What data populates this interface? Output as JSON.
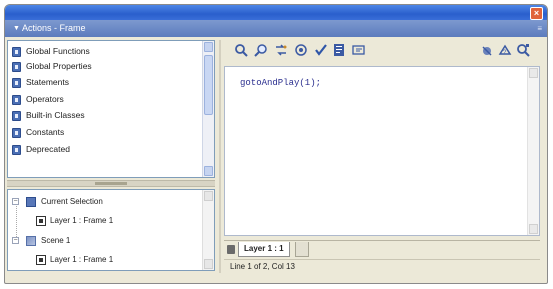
{
  "window": {
    "close_glyph": "×",
    "panel_title": "Actions - Frame",
    "collapse_arrow": "▼",
    "grip_glyph": "≡"
  },
  "toolbox": {
    "categories": [
      {
        "label": "Global Functions",
        "icon": "book-icon"
      },
      {
        "label": "Global Properties",
        "icon": "book-icon"
      },
      {
        "label": "Statements",
        "icon": "book-icon"
      },
      {
        "label": "Operators",
        "icon": "book-icon"
      },
      {
        "label": "Built-in Classes",
        "icon": "book-icon"
      },
      {
        "label": "Constants",
        "icon": "book-icon"
      },
      {
        "label": "Deprecated",
        "icon": "book-icon"
      }
    ]
  },
  "navigator": {
    "current_selection": "Current Selection",
    "current_frame": "Layer 1 : Frame 1",
    "scene": "Scene 1",
    "scene_frame": "Layer 1 : Frame 1",
    "expander_minus": "−"
  },
  "toolbar": {
    "buttons": [
      {
        "name": "add-action-icon"
      },
      {
        "name": "find-icon"
      },
      {
        "name": "replace-icon"
      },
      {
        "name": "target-path-icon"
      },
      {
        "name": "check-syntax-icon"
      },
      {
        "name": "auto-format-icon"
      },
      {
        "name": "code-hint-icon"
      },
      {
        "name": "debug-options-icon"
      },
      {
        "name": "reference-icon"
      },
      {
        "name": "view-options-icon"
      }
    ]
  },
  "editor": {
    "code": "gotoAndPlay(1);"
  },
  "script_tab": {
    "label": "Layer 1 : 1"
  },
  "status": {
    "text": "Line 1 of 2, Col 13"
  }
}
